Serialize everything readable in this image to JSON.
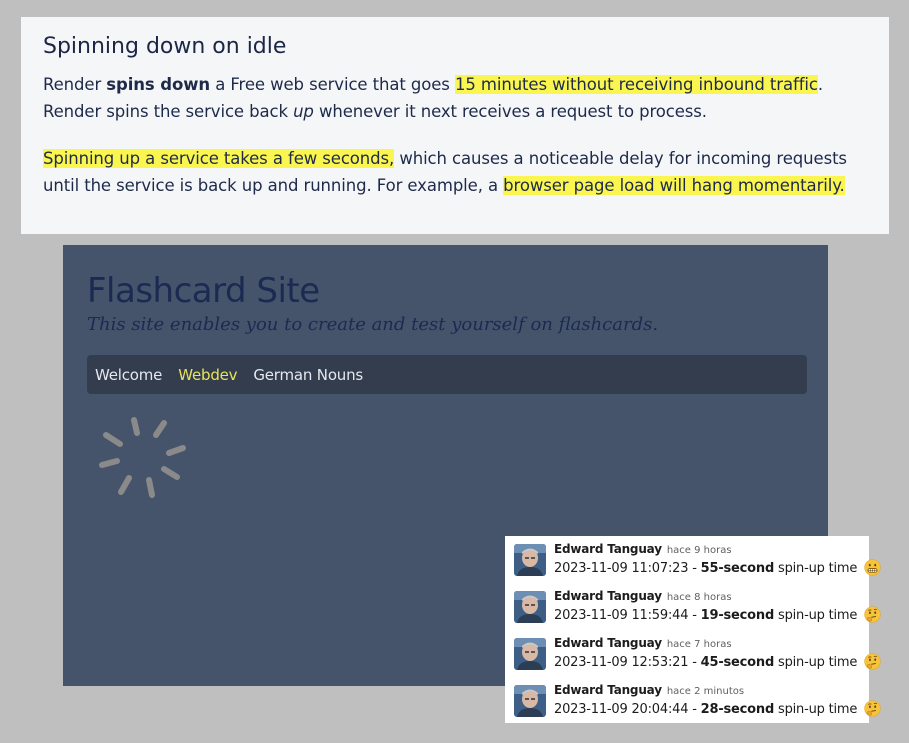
{
  "doc": {
    "heading": "Spinning down on idle",
    "p1": {
      "t1": "Render ",
      "bold": "spins down",
      "t2": " a Free web service that goes ",
      "highlight": "15 minutes without receiving inbound traffic",
      "t3": ". Render spins the service back ",
      "italic": "up",
      "t4": " whenever it next receives a request to process."
    },
    "p2": {
      "highlight1": "Spinning up a service takes a few seconds,",
      "t1": " which causes a noticeable delay for incoming requests until the service is back up and running. For example, a ",
      "highlight2": "browser page load will hang momentarily."
    }
  },
  "site": {
    "title": "Flashcard Site",
    "subtitle": "This site enables you to create and test yourself on flashcards.",
    "nav": [
      {
        "label": "Welcome",
        "active": false
      },
      {
        "label": "Webdev",
        "active": true
      },
      {
        "label": "German Nouns",
        "active": false
      }
    ],
    "spinner_icon": "loading-spinner-icon",
    "colors": {
      "background": "#46546b",
      "nav_bg": "#333d4d",
      "title": "#1b2a52",
      "active_nav": "#e8e35c"
    }
  },
  "comments": [
    {
      "author": "Edward Tanguay",
      "time": "hace 9 horas",
      "timestamp": "2023-11-09 11:07:23 - ",
      "duration": "55-second",
      "suffix": " spin-up time",
      "emoji": "grimacing-face-icon"
    },
    {
      "author": "Edward Tanguay",
      "time": "hace 8 horas",
      "timestamp": "2023-11-09 11:59:44 - ",
      "duration": "19-second",
      "suffix": " spin-up time",
      "emoji": "thinking-face-icon"
    },
    {
      "author": "Edward Tanguay",
      "time": "hace 7 horas",
      "timestamp": "2023-11-09 12:53:21 - ",
      "duration": "45-second",
      "suffix": " spin-up time",
      "emoji": "thinking-face-icon"
    },
    {
      "author": "Edward Tanguay",
      "time": "hace 2 minutos",
      "timestamp": "2023-11-09 20:04:44 - ",
      "duration": "28-second",
      "suffix": " spin-up time",
      "emoji": "thinking-face-icon"
    }
  ],
  "colors": {
    "page_bg": "#bfbfbf",
    "doc_bg": "#f5f6f8",
    "highlight": "#faf64f"
  }
}
